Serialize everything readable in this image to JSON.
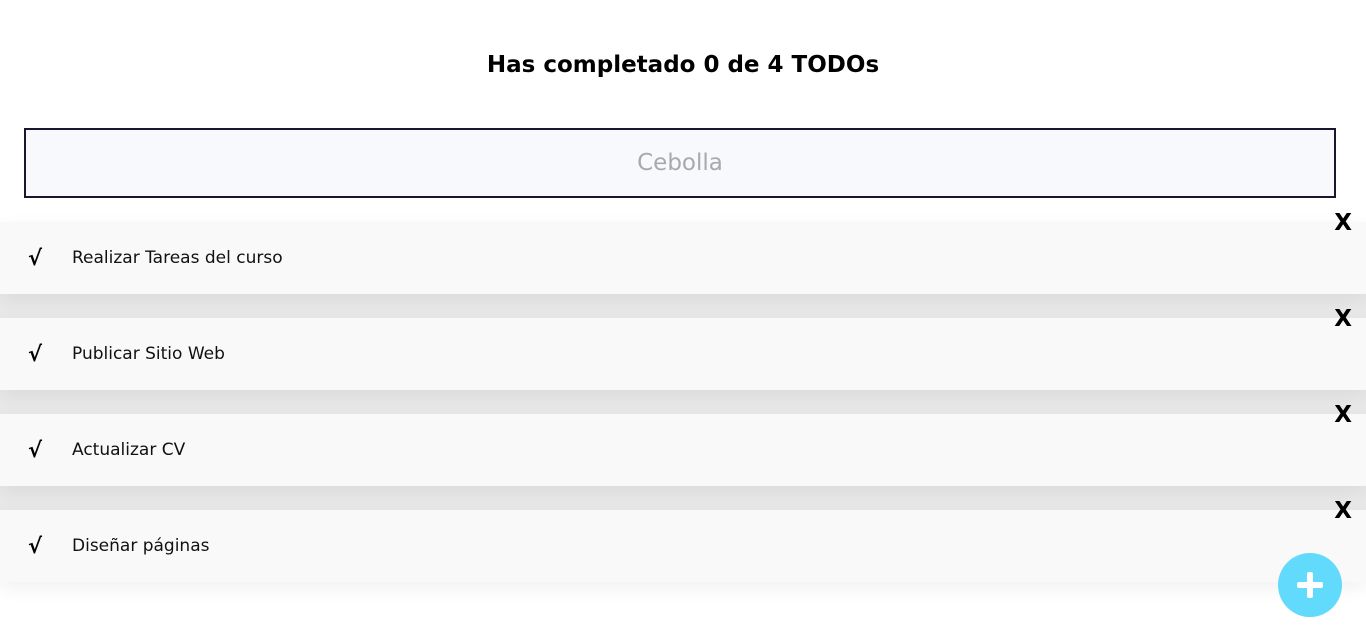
{
  "header": {
    "title": "Has completado 0 de 4 TODOs"
  },
  "search": {
    "placeholder": "Cebolla",
    "value": ""
  },
  "todos": [
    {
      "check_icon": "√",
      "text": "Realizar Tareas del curso",
      "delete_label": "X"
    },
    {
      "check_icon": "√",
      "text": "Publicar Sitio Web",
      "delete_label": "X"
    },
    {
      "check_icon": "√",
      "text": "Actualizar CV",
      "delete_label": "X"
    },
    {
      "check_icon": "√",
      "text": "Diseñar páginas",
      "delete_label": "X"
    }
  ],
  "fab": {
    "icon": "plus-icon",
    "color": "#61dafb"
  }
}
